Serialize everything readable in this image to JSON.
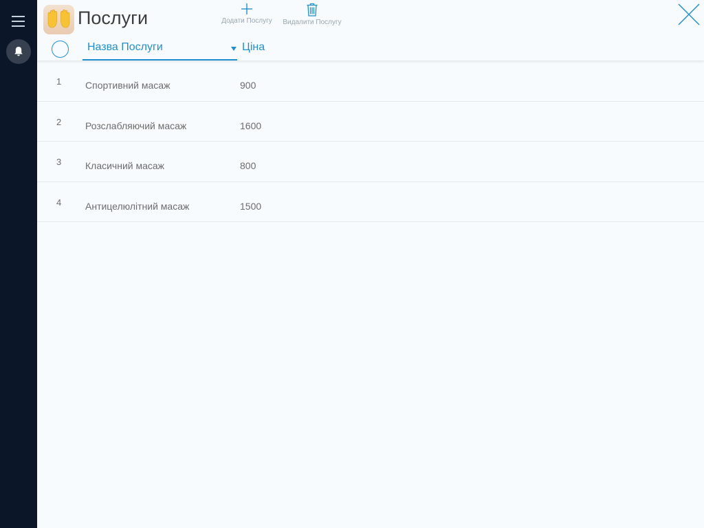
{
  "colors": {
    "sidebar_bg": "#0b1628",
    "accent": "#1f8fd0",
    "main_bg": "#f7fbfd"
  },
  "sidebar": {
    "icons": [
      "menu-icon",
      "bell-icon"
    ]
  },
  "header": {
    "app_icon": "raised-hands-icon",
    "title": "Послуги",
    "add_label": "Додати Послугу",
    "delete_label": "Видалити Послугу",
    "close_icon": "close-icon"
  },
  "table": {
    "columns": {
      "name": "Назва Послуги",
      "price": "Ціна"
    },
    "sorted_by": "name",
    "rows": [
      {
        "num": "1",
        "name": "Спортивний масаж",
        "price": "900"
      },
      {
        "num": "2",
        "name": "Розслабляючий масаж",
        "price": "1600"
      },
      {
        "num": "3",
        "name": "Класичний масаж",
        "price": "800"
      },
      {
        "num": "4",
        "name": "Антицелюлітний масаж",
        "price": "1500"
      }
    ]
  }
}
